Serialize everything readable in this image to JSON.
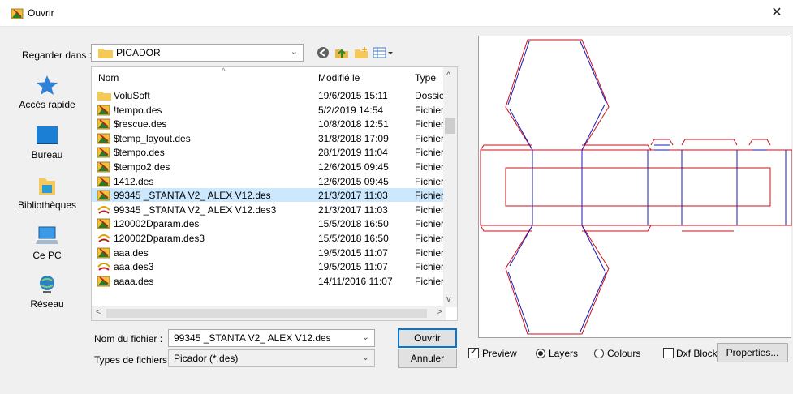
{
  "window": {
    "title": "Ouvrir",
    "close_glyph": "✕"
  },
  "lookin": {
    "label": "Regarder dans :",
    "value": "PICADOR"
  },
  "places": [
    {
      "label": "Accès rapide",
      "icon": "star-icon"
    },
    {
      "label": "Bureau",
      "icon": "desktop-icon"
    },
    {
      "label": "Bibliothèques",
      "icon": "library-icon"
    },
    {
      "label": "Ce PC",
      "icon": "computer-icon"
    },
    {
      "label": "Réseau",
      "icon": "network-icon"
    }
  ],
  "columns": {
    "name": "Nom",
    "modified": "Modifié le",
    "type": "Type"
  },
  "files": [
    {
      "name": "VoluSoft",
      "modified": "19/6/2015 15:11",
      "type": "Dossie",
      "icon": "folder"
    },
    {
      "name": "!tempo.des",
      "modified": "5/2/2019 14:54",
      "type": "Fichier",
      "icon": "des"
    },
    {
      "name": "$rescue.des",
      "modified": "10/8/2018 12:51",
      "type": "Fichier",
      "icon": "des"
    },
    {
      "name": "$temp_layout.des",
      "modified": "31/8/2018 17:09",
      "type": "Fichier",
      "icon": "des"
    },
    {
      "name": "$tempo.des",
      "modified": "28/1/2019 11:04",
      "type": "Fichier",
      "icon": "des"
    },
    {
      "name": "$tempo2.des",
      "modified": "12/6/2015 09:45",
      "type": "Fichier",
      "icon": "des"
    },
    {
      "name": "1412.des",
      "modified": "12/6/2015 09:45",
      "type": "Fichier",
      "icon": "des"
    },
    {
      "name": "99345 _STANTA V2_ ALEX V12.des",
      "modified": "21/3/2017 11:03",
      "type": "Fichier",
      "icon": "des",
      "selected": true
    },
    {
      "name": "99345 _STANTA V2_ ALEX V12.des3",
      "modified": "21/3/2017 11:03",
      "type": "Fichier",
      "icon": "des3"
    },
    {
      "name": "120002Dparam.des",
      "modified": "15/5/2018 16:50",
      "type": "Fichier",
      "icon": "des"
    },
    {
      "name": "120002Dparam.des3",
      "modified": "15/5/2018 16:50",
      "type": "Fichier",
      "icon": "des3"
    },
    {
      "name": "aaa.des",
      "modified": "19/5/2015 11:07",
      "type": "Fichier",
      "icon": "des"
    },
    {
      "name": "aaa.des3",
      "modified": "19/5/2015 11:07",
      "type": "Fichier",
      "icon": "des3"
    },
    {
      "name": "aaaa.des",
      "modified": "14/11/2016 11:07",
      "type": "Fichier",
      "icon": "des"
    }
  ],
  "filename": {
    "label": "Nom du fichier :",
    "value": "99345 _STANTA V2_ ALEX V12.des"
  },
  "filetype": {
    "label": "Types de fichiers :",
    "value": "Picador (*.des)"
  },
  "buttons": {
    "open": "Ouvrir",
    "cancel": "Annuler",
    "properties": "Properties..."
  },
  "options": {
    "preview": {
      "label": "Preview",
      "checked": true
    },
    "layers": {
      "label": "Layers",
      "selected": true
    },
    "colours": {
      "label": "Colours",
      "selected": false
    },
    "dxf_block": {
      "label": "Dxf Block",
      "checked": false
    }
  },
  "colors": {
    "cut_line": "#c8101e",
    "crease_line": "#1a1ab4",
    "selection": "#cce8ff",
    "accent": "#0078d7"
  }
}
